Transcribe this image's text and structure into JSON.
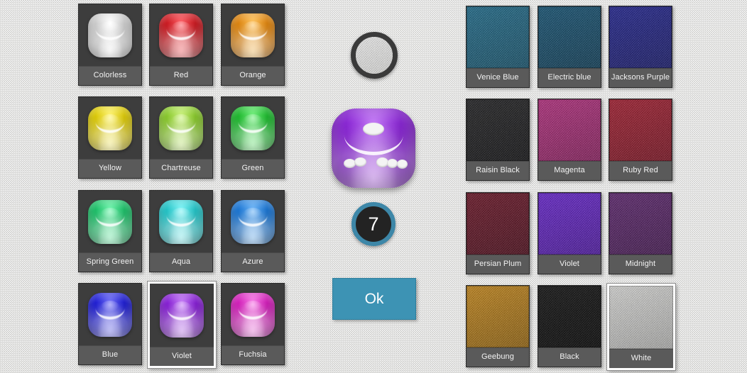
{
  "background": {
    "texture_name": "white-felt-texture",
    "color": "#dcdcda"
  },
  "dice_panel": {
    "name": "dice-color-palette",
    "selected": "Violet",
    "columns": 3,
    "items": [
      {
        "label": "Colorless",
        "color": "#d8d8d8",
        "dark": "#9a9a9a",
        "light": "#ffffff"
      },
      {
        "label": "Red",
        "color": "#d8141c",
        "dark": "#8d0a10",
        "light": "#ff5c62"
      },
      {
        "label": "Orange",
        "color": "#e98a0a",
        "dark": "#a85c00",
        "light": "#ffc35c"
      },
      {
        "label": "Yellow",
        "color": "#e8d400",
        "dark": "#a39400",
        "light": "#fff470"
      },
      {
        "label": "Chartreuse",
        "color": "#8ed22a",
        "dark": "#5e9414",
        "light": "#caf27a"
      },
      {
        "label": "Green",
        "color": "#19c02a",
        "dark": "#0d8a1c",
        "light": "#6ff07a"
      },
      {
        "label": "Spring Green",
        "color": "#18c86a",
        "dark": "#0d8c48",
        "light": "#6ef5ac"
      },
      {
        "label": "Aqua",
        "color": "#1ecdd0",
        "dark": "#129093",
        "light": "#7df4f6"
      },
      {
        "label": "Azure",
        "color": "#1579e0",
        "dark": "#0b4f96",
        "light": "#6bb4f7"
      },
      {
        "label": "Blue",
        "color": "#1a19e0",
        "dark": "#0f0e96",
        "light": "#6f6ef7"
      },
      {
        "label": "Violet",
        "color": "#8b1ae0",
        "dark": "#5c0d98",
        "light": "#c57bf7"
      },
      {
        "label": "Fuchsia",
        "color": "#e01ac4",
        "dark": "#960d84",
        "light": "#f77be6"
      }
    ]
  },
  "felt_panel": {
    "name": "table-felt-palette",
    "selected": "White",
    "columns": 3,
    "items": [
      {
        "label": "Venice Blue",
        "color": "#1a6c8e",
        "dark": "#13526c"
      },
      {
        "label": "Electric blue",
        "color": "#0f5276",
        "dark": "#0a3b56"
      },
      {
        "label": "Jacksons Purple",
        "color": "#1d1f94",
        "dark": "#14166b"
      },
      {
        "label": "Raisin Black",
        "color": "#1c1c1e",
        "dark": "#0e0e10"
      },
      {
        "label": "Magenta",
        "color": "#ba2a81",
        "dark": "#8a1c5e"
      },
      {
        "label": "Ruby Red",
        "color": "#a8182c",
        "dark": "#7c0f1f"
      },
      {
        "label": "Persian Plum",
        "color": "#6c0f22",
        "dark": "#4c0818"
      },
      {
        "label": "Violet",
        "color": "#6820d8",
        "dark": "#4d15a4"
      },
      {
        "label": "Midnight",
        "color": "#5d2170",
        "dark": "#431550"
      },
      {
        "label": "Geebung",
        "color": "#cc8a16",
        "dark": "#96650d"
      },
      {
        "label": "Black",
        "color": "#0a0a0a",
        "dark": "#000000"
      },
      {
        "label": "White",
        "color": "#e2e2e0",
        "dark": "#b4b4b2"
      }
    ]
  },
  "center": {
    "felt_preview": {
      "name": "felt-preview-circle",
      "color": "#ffffff",
      "ring_color": "#3a3a3a"
    },
    "die_preview": {
      "name": "die-preview",
      "color": "#8b1ae0",
      "dark": "#5c0d98",
      "light": "#c57bf7",
      "pip_count": 6
    },
    "dice_count_badge": {
      "name": "dice-count-badge",
      "value": "7",
      "ring_color": "#3d87a8",
      "fill_color": "#232323"
    },
    "ok_button": {
      "name": "ok-button",
      "label": "Ok",
      "color": "#3d93b4"
    }
  }
}
